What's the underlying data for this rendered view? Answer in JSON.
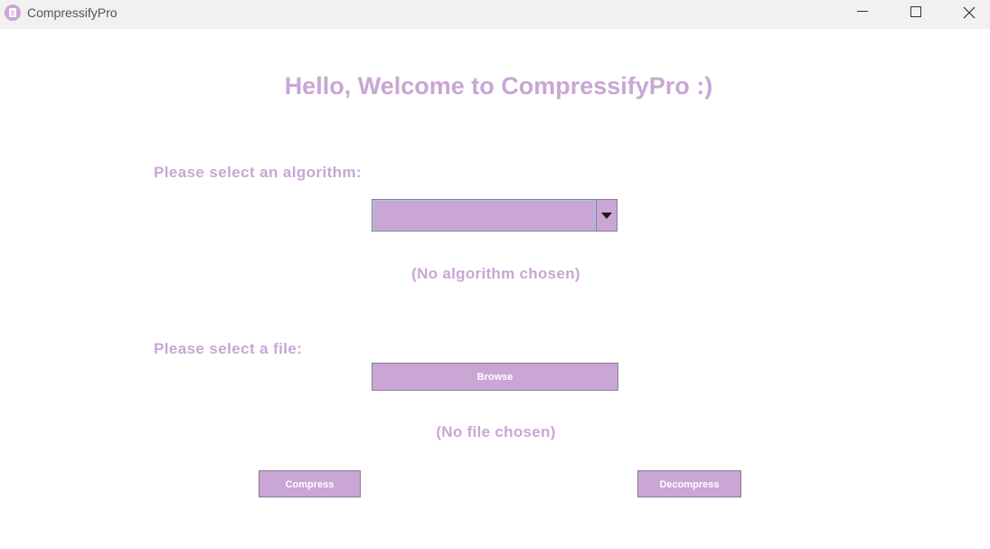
{
  "window": {
    "title": "CompressifyPro",
    "icon": "app-document-icon",
    "controls": {
      "minimize_icon": "minimize-icon",
      "maximize_icon": "maximize-icon",
      "close_icon": "close-icon"
    }
  },
  "main": {
    "welcome_text": "Hello, Welcome to CompressifyPro :)",
    "algorithm": {
      "label": "Please select an algorithm:",
      "selected_value": "",
      "status_text": "(No algorithm chosen)"
    },
    "file": {
      "label": "Please select a file:",
      "browse_label": "Browse",
      "status_text": "(No file chosen)"
    },
    "actions": {
      "compress_label": "Compress",
      "decompress_label": "Decompress"
    }
  },
  "colors": {
    "accent": "#c9a6d4",
    "accent_border": "#8d7a99",
    "titlebar_bg": "#f1f1f1",
    "background": "#ffffff"
  }
}
